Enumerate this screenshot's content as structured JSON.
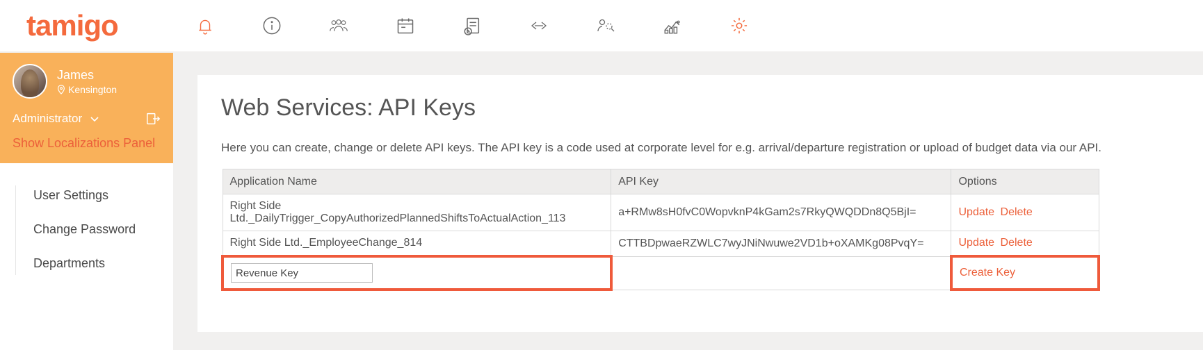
{
  "brand": "tamigo",
  "profile": {
    "name": "James",
    "location": "Kensington",
    "role": "Administrator"
  },
  "show_loc_panel": "Show Localizations Panel",
  "sidebar_items": [
    "User Settings",
    "Change Password",
    "Departments"
  ],
  "page": {
    "title": "Web Services: API Keys",
    "intro": "Here you can create, change or delete API keys. The API key is a code used at corporate level for e.g. arrival/departure registration or upload of budget data via our API."
  },
  "table": {
    "headers": {
      "name": "Application Name",
      "key": "API Key",
      "options": "Options"
    },
    "rows": [
      {
        "name": "Right Side Ltd._DailyTrigger_CopyAuthorizedPlannedShiftsToActualAction_113",
        "key": "a+RMw8sH0fvC0WopvknP4kGam2s7RkyQWQDDn8Q5BjI=",
        "update": "Update",
        "delete": "Delete"
      },
      {
        "name": "Right Side Ltd._EmployeeChange_814",
        "key": "CTTBDpwaeRZWLC7wyJNiNwuwe2VD1b+oXAMKg08PvqY=",
        "update": "Update",
        "delete": "Delete"
      }
    ],
    "new_row": {
      "name_value": "Revenue Key",
      "create": "Create Key"
    }
  }
}
